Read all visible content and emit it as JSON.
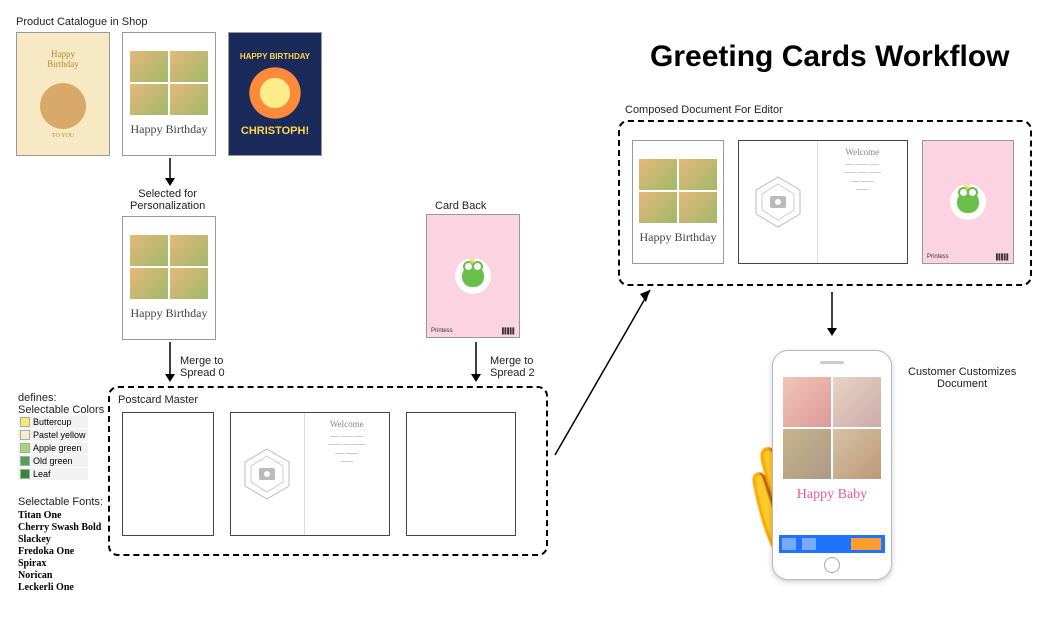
{
  "title": "Greeting Cards Workflow",
  "labels": {
    "catalogue": "Product Catalogue in Shop",
    "selected": "Selected for\nPersonalization",
    "cardback": "Card Back",
    "merge0": "Merge to\nSpread 0",
    "merge2": "Merge to\nSpread 2",
    "postcard_master": "Postcard Master",
    "defines": "defines:\nSelectable Colors",
    "selectable_fonts": "Selectable Fonts:",
    "composed": "Composed Document For Editor",
    "customizes": "Customer Customizes\nDocument"
  },
  "card1_text": "Happy\nBirthday",
  "card1_foot": "TO YOU",
  "card2_text": "Happy Birthday",
  "card3_top": "HAPPY BIRTHDAY",
  "card3_name": "CHRISTOPH!",
  "invite_head": "Welcome",
  "back_brand": "Printess",
  "colors": [
    {
      "name": "Buttercup",
      "hex": "#f6e96b"
    },
    {
      "name": "Pastel yellow",
      "hex": "#f3efc8"
    },
    {
      "name": "Apple green",
      "hex": "#a4d86f"
    },
    {
      "name": "Old green",
      "hex": "#4e9f5a"
    },
    {
      "name": "Leaf",
      "hex": "#2f8b3a"
    }
  ],
  "fonts": [
    "Titan One",
    "Cherry Swash Bold",
    "Slackey",
    "Fredoka One",
    "Spirax",
    "Norican",
    "Leckerli One"
  ],
  "phone_text": "Happy Baby"
}
